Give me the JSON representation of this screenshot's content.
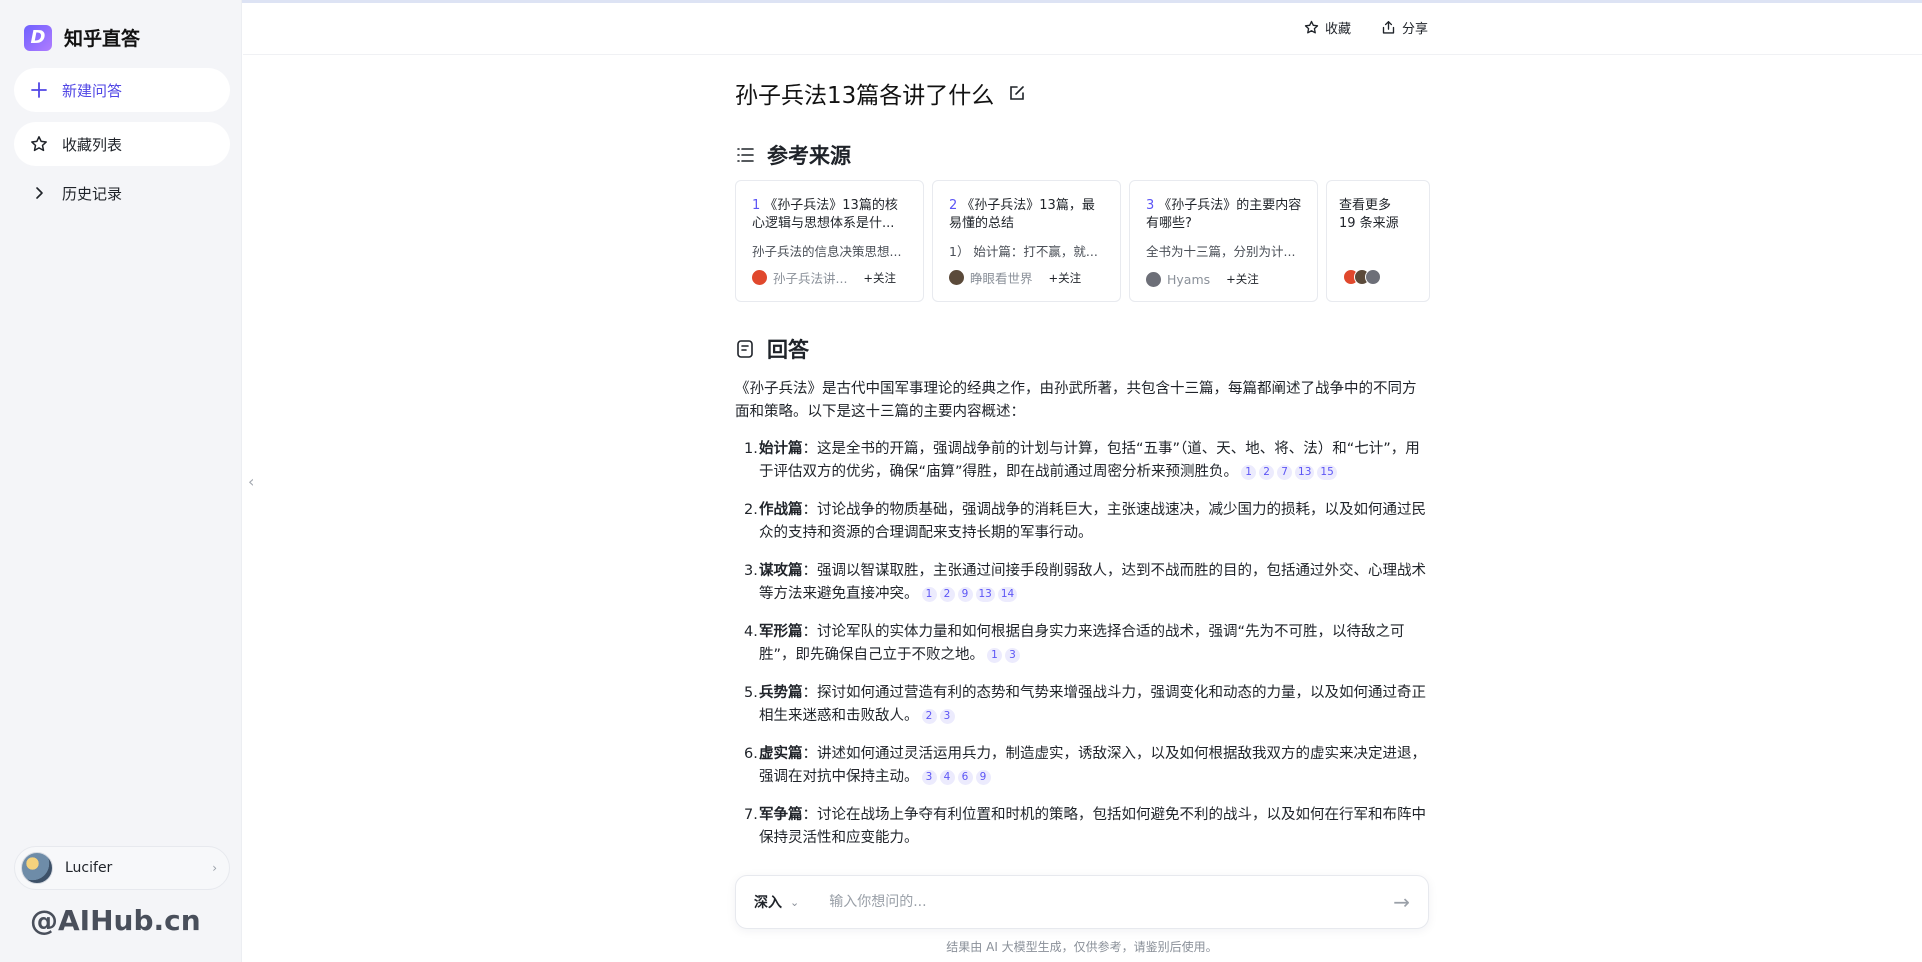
{
  "app": {
    "name": "知乎直答"
  },
  "sidebar": {
    "new_question": "新建问答",
    "favorites": "收藏列表",
    "history": "历史记录",
    "user": {
      "name": "Lucifer"
    },
    "watermark": "@AIHub.cn"
  },
  "header": {
    "collect": "收藏",
    "share": "分享"
  },
  "question": {
    "title": "孙子兵法13篇各讲了什么"
  },
  "references": {
    "heading": "参考来源",
    "cards": [
      {
        "num": "1",
        "title": "《孙子兵法》13篇的核心逻辑与思想体系是什...",
        "snippet": "孙子兵法的信息决策思想...",
        "author": "孙子兵法讲...",
        "follow": "+关注",
        "avatar_color": "#e0482d"
      },
      {
        "num": "2",
        "title": "《孙子兵法》13篇，最易懂的总结",
        "snippet": "1） 始计篇：打不赢，就...",
        "author": "睁眼看世界",
        "follow": "+关注",
        "avatar_color": "#5b4a3a"
      },
      {
        "num": "3",
        "title": "《孙子兵法》的主要内容有哪些?",
        "snippet": "全书为十三篇，分别为计...",
        "author": "Hyams",
        "follow": "+关注",
        "avatar_color": "#6d6f78"
      }
    ],
    "more": {
      "line1": "查看更多",
      "line2": "19 条来源",
      "avatar_colors": [
        "#e0482d",
        "#5b4a3a",
        "#6d6f78"
      ]
    }
  },
  "answer": {
    "heading": "回答",
    "intro": "《孙子兵法》是古代中国军事理论的经典之作，由孙武所著，共包含十三篇，每篇都阐述了战争中的不同方面和策略。以下是这十三篇的主要内容概述：",
    "items": [
      {
        "num": "1.",
        "name": "始计篇",
        "text": "：这是全书的开篇，强调战争前的计划与计算，包括“五事”（道、天、地、将、法）和“七计”，用于评估双方的优劣，确保“庙算”得胜，即在战前通过周密分析来预测胜负。",
        "cites": [
          "1",
          "2",
          "7",
          "13",
          "15"
        ]
      },
      {
        "num": "2.",
        "name": "作战篇",
        "text": "：讨论战争的物质基础，强调战争的消耗巨大，主张速战速决，减少国力的损耗，以及如何通过民众的支持和资源的合理调配来支持长期的军事行动。",
        "cites": []
      },
      {
        "num": "3.",
        "name": "谋攻篇",
        "text": "：强调以智谋取胜，主张通过间接手段削弱敌人，达到不战而胜的目的，包括通过外交、心理战术等方法来避免直接冲突。",
        "cites": [
          "1",
          "2",
          "9",
          "13",
          "14"
        ]
      },
      {
        "num": "4.",
        "name": "军形篇",
        "text": "：讨论军队的实体力量和如何根据自身实力来选择合适的战术，强调“先为不可胜，以待敌之可胜”，即先确保自己立于不败之地。",
        "cites": [
          "1",
          "3"
        ]
      },
      {
        "num": "5.",
        "name": "兵势篇",
        "text": "：探讨如何通过营造有利的态势和气势来增强战斗力，强调变化和动态的力量，以及如何通过奇正相生来迷惑和击败敌人。",
        "cites": [
          "2",
          "3"
        ]
      },
      {
        "num": "6.",
        "name": "虚实篇",
        "text": "：讲述如何通过灵活运用兵力，制造虚实，诱敌深入，以及如何根据敌我双方的虚实来决定进退，强调在对抗中保持主动。",
        "cites": [
          "3",
          "4",
          "6",
          "9"
        ]
      },
      {
        "num": "7.",
        "name": "军争篇",
        "text": "：讨论在战场上争夺有利位置和时机的策略，包括如何避免不利的战斗，以及如何在行军和布阵中保持灵活性和应变能力。",
        "cites": []
      }
    ]
  },
  "input": {
    "mode": "深入",
    "placeholder": "输入你想问的..."
  },
  "footer": {
    "disclaimer": "结果由 AI 大模型生成，仅供参考，请鉴别后使用。"
  },
  "colors": {
    "accent": "#5c55f5",
    "sidebar_bg": "#f4f5f8"
  }
}
